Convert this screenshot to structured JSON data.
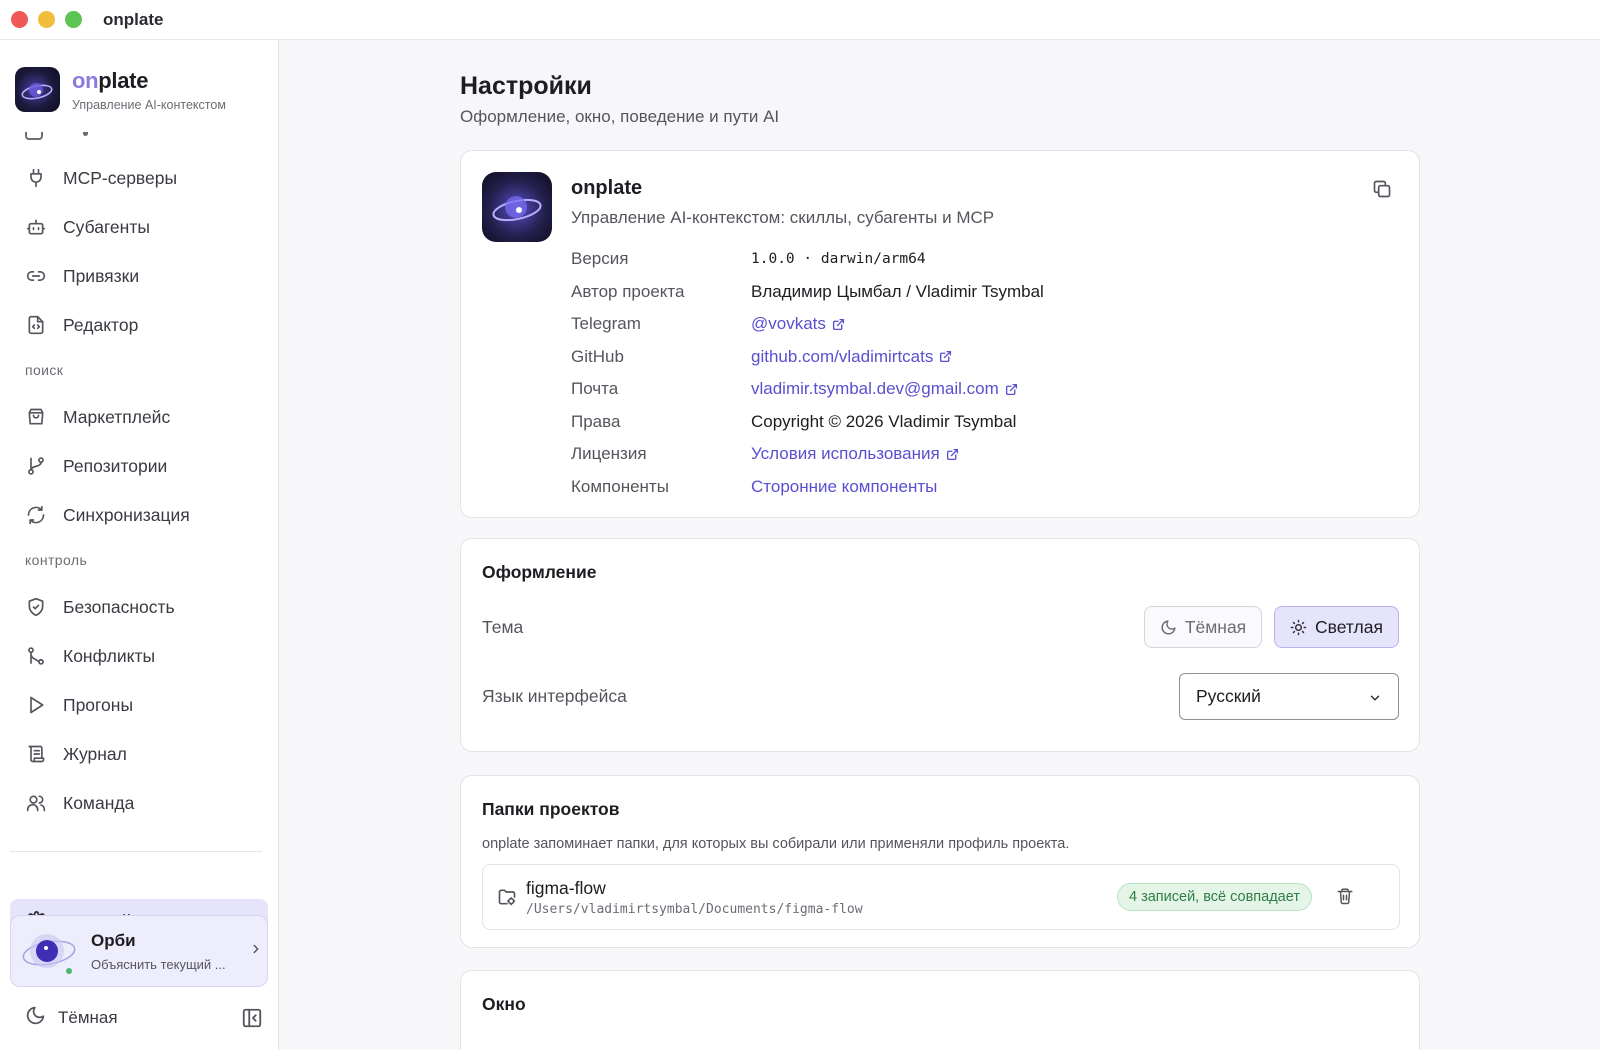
{
  "window": {
    "title": "onplate"
  },
  "brand": {
    "name_accent": "on",
    "name_rest": "plate",
    "subtitle": "Управление AI-контекстом"
  },
  "sidebar": {
    "items_top": [
      {
        "label": "MCP-серверы",
        "icon": "plug-icon"
      },
      {
        "label": "Субагенты",
        "icon": "bot-icon"
      },
      {
        "label": "Привязки",
        "icon": "link-icon"
      },
      {
        "label": "Редактор",
        "icon": "file-code-icon"
      }
    ],
    "section_search": "поиск",
    "items_search": [
      {
        "label": "Маркетплейс",
        "icon": "store-icon"
      },
      {
        "label": "Репозитории",
        "icon": "git-branch-icon"
      },
      {
        "label": "Синхронизация",
        "icon": "refresh-icon"
      }
    ],
    "section_control": "контроль",
    "items_control": [
      {
        "label": "Безопасность",
        "icon": "shield-icon"
      },
      {
        "label": "Конфликты",
        "icon": "merge-icon"
      },
      {
        "label": "Прогоны",
        "icon": "play-icon"
      },
      {
        "label": "Журнал",
        "icon": "scroll-icon"
      },
      {
        "label": "Команда",
        "icon": "users-icon"
      }
    ],
    "active_item": {
      "label": "Настройки",
      "icon": "gear-icon"
    },
    "orbi": {
      "name": "Орби",
      "subtitle": "Объяснить текущий ..."
    },
    "footer_theme": "Тёмная"
  },
  "page": {
    "title": "Настройки",
    "subtitle": "Оформление, окно, поведение и пути AI"
  },
  "about": {
    "name": "onplate",
    "description": "Управление AI-контекстом: скиллы, субагенты и MCP",
    "rows": {
      "version": {
        "label": "Версия",
        "value": "1.0.0 · darwin/arm64"
      },
      "author": {
        "label": "Автор проекта",
        "value": "Владимир Цымбал / Vladimir Tsymbal"
      },
      "telegram": {
        "label": "Telegram",
        "value": "@vovkats"
      },
      "github": {
        "label": "GitHub",
        "value": "github.com/vladimirtcats"
      },
      "email": {
        "label": "Почта",
        "value": "vladimir.tsymbal.dev@gmail.com"
      },
      "rights": {
        "label": "Права",
        "value": "Copyright © 2026 Vladimir Tsymbal"
      },
      "license": {
        "label": "Лицензия",
        "value": "Условия использования"
      },
      "components": {
        "label": "Компоненты",
        "value": "Сторонние компоненты"
      }
    }
  },
  "appearance": {
    "title": "Оформление",
    "theme_label": "Тема",
    "theme_dark": "Тёмная",
    "theme_light": "Светлая",
    "selected_theme": "Светлая",
    "language_label": "Язык интерфейса",
    "language_value": "Русский"
  },
  "folders": {
    "title": "Папки проектов",
    "description": "onplate запоминает папки, для которых вы собирали или применяли профиль проекта.",
    "items": [
      {
        "name": "figma-flow",
        "path": "/Users/vladimirtsymbal/Documents/figma-flow",
        "status": "4 записей, всё совпадает"
      }
    ]
  },
  "window_section": {
    "title": "Окно"
  },
  "colors": {
    "accent": "#5a4fd0",
    "active_bg": "#e5e4fb",
    "success": "#2f7d45"
  }
}
